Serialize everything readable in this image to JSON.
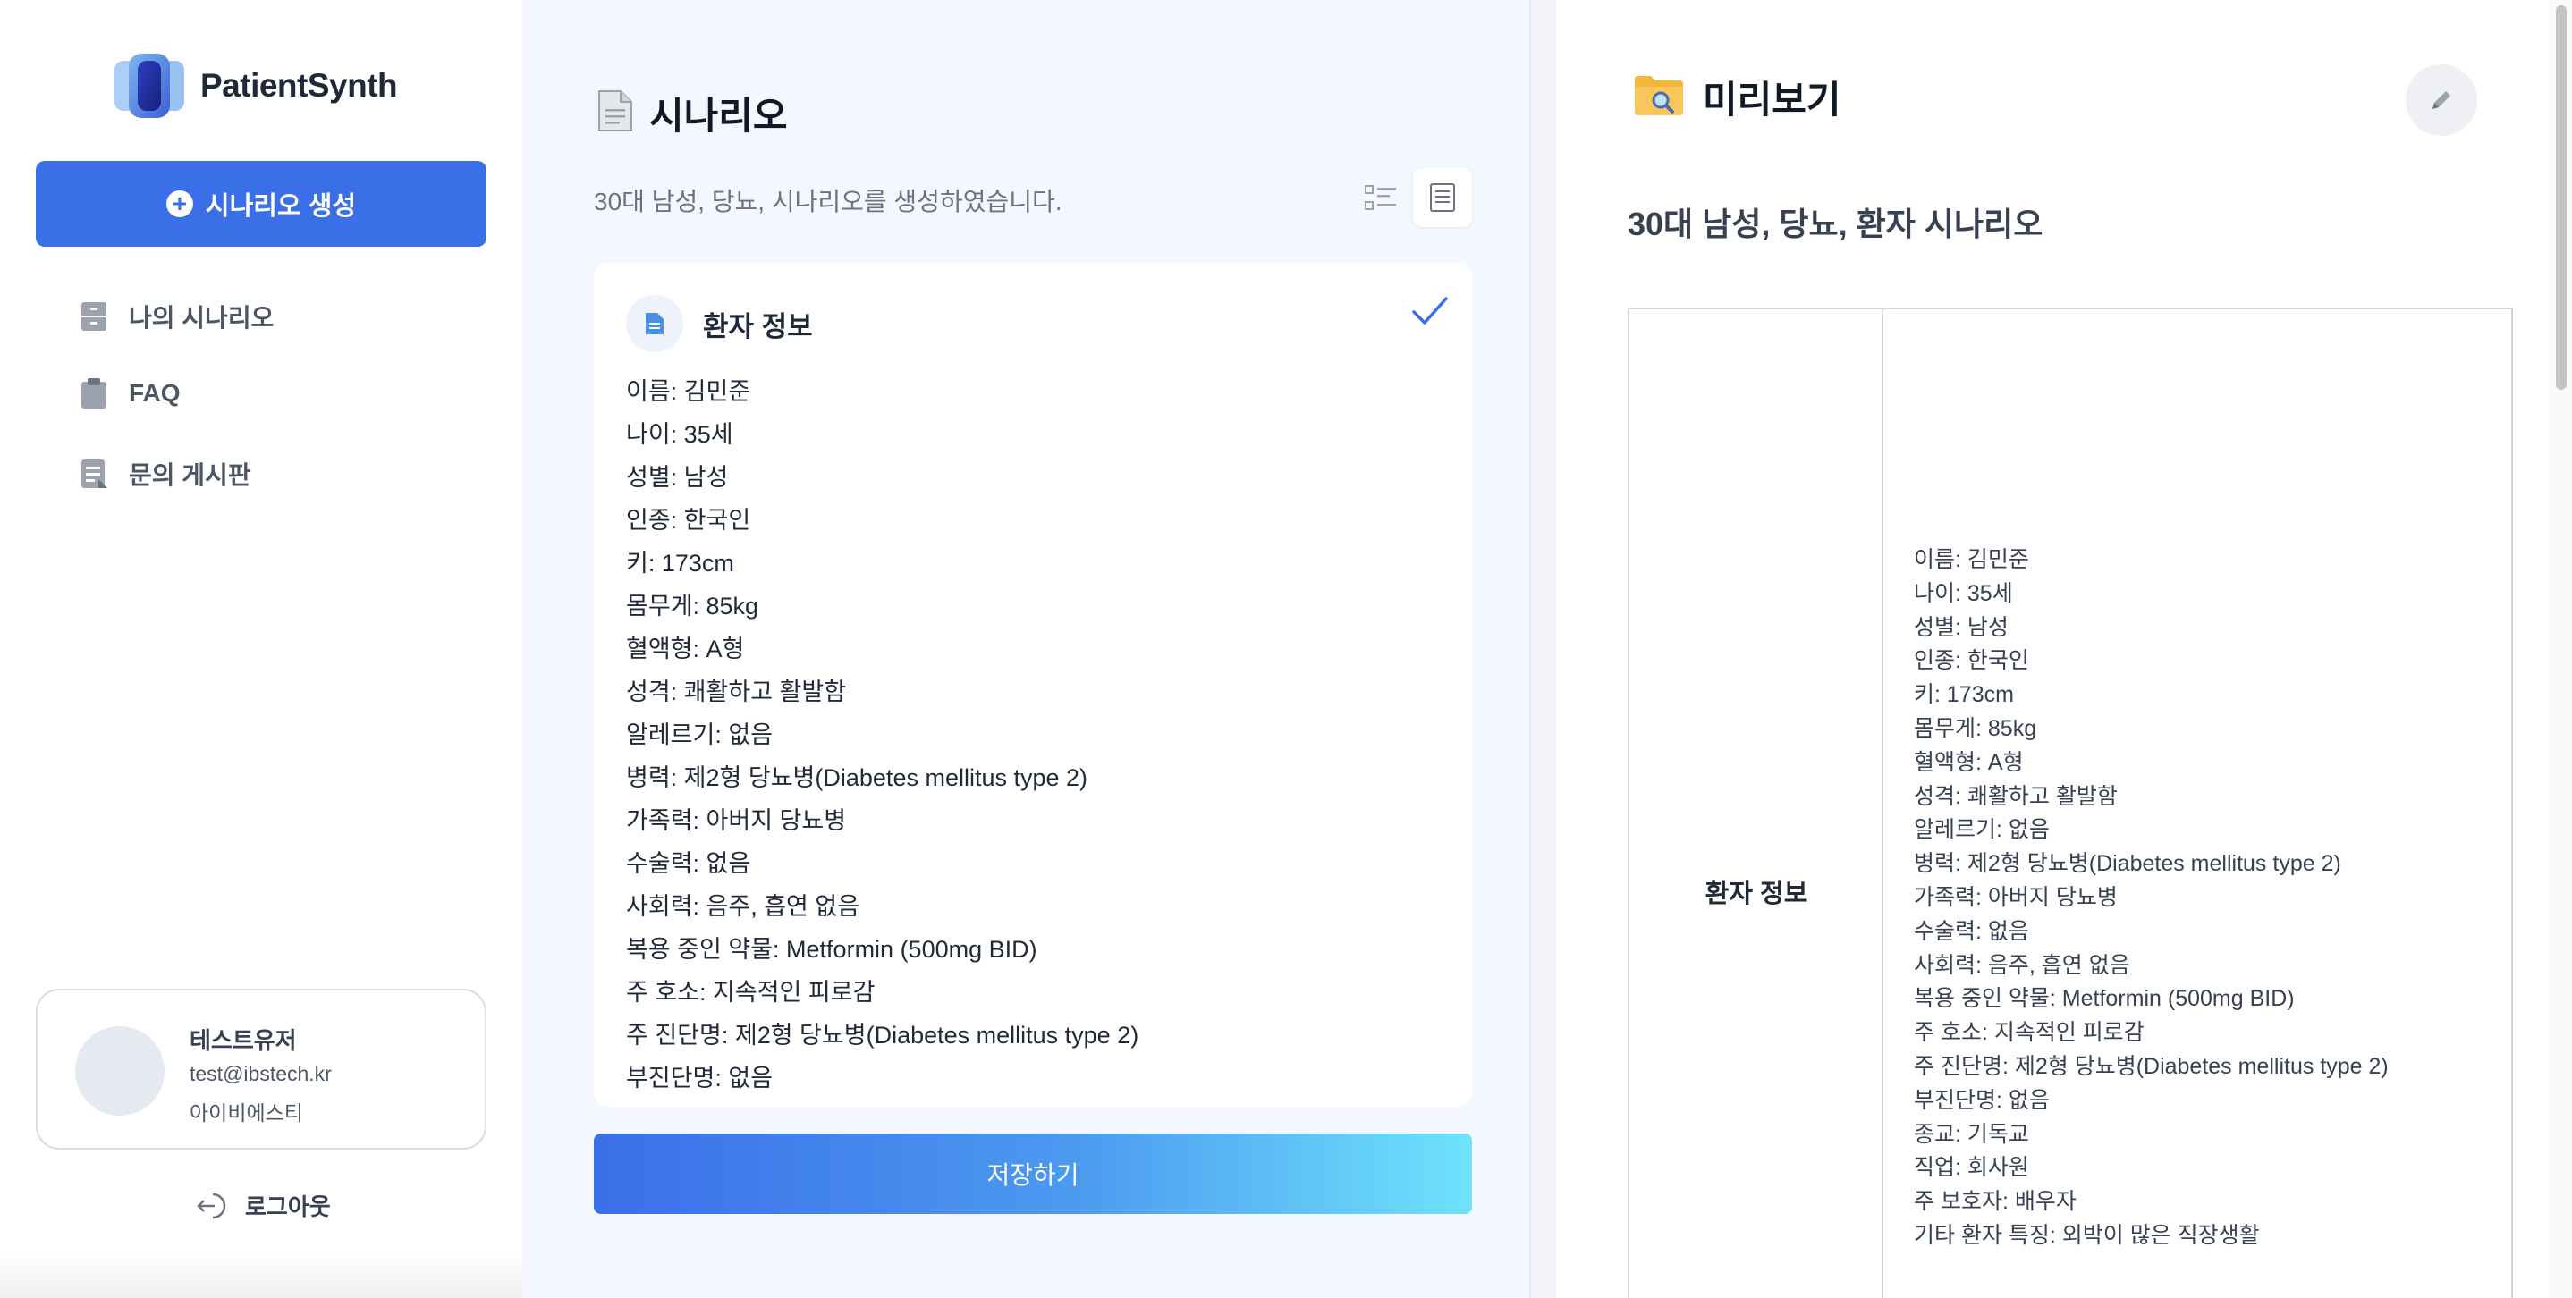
{
  "sidebar": {
    "brand": "PatientSynth",
    "create_button": "시나리오 생성",
    "items": [
      {
        "label": "나의 시나리오",
        "icon": "cabinet-icon"
      },
      {
        "label": "FAQ",
        "icon": "clipboard-icon"
      },
      {
        "label": "문의 게시판",
        "icon": "document-list-icon"
      }
    ],
    "profile": {
      "name": "테스트유저",
      "email": "test@ibstech.kr",
      "org": "아이비에스티"
    },
    "logout_label": "로그아웃"
  },
  "scenario": {
    "title": "시나리오",
    "subtitle": "30대 남성, 당뇨, 시나리오를 생성하였습니다.",
    "card_title": "환자 정보",
    "items": [
      "이름: 김민준",
      "나이: 35세",
      "성별: 남성",
      "인종: 한국인",
      "키: 173cm",
      "몸무게: 85kg",
      "혈액형: A형",
      "성격: 쾌활하고 활발함",
      "알레르기: 없음",
      "병력: 제2형 당뇨병(Diabetes mellitus type 2)",
      "가족력: 아버지 당뇨병",
      "수술력: 없음",
      "사회력: 음주, 흡연 없음",
      "복용 중인 약물: Metformin (500mg BID)",
      "주 호소: 지속적인 피로감",
      "주 진단명: 제2형 당뇨병(Diabetes mellitus type 2)",
      "부진단명: 없음"
    ],
    "save_button": "저장하기"
  },
  "preview": {
    "title": "미리보기",
    "doc_title": "30대 남성, 당뇨, 환자 시나리오",
    "section_label": "환자 정보",
    "items": [
      "이름: 김민준",
      "나이: 35세",
      "성별: 남성",
      "인종: 한국인",
      "키: 173cm",
      "몸무게: 85kg",
      "혈액형: A형",
      "성격: 쾌활하고 활발함",
      "알레르기: 없음",
      "병력: 제2형 당뇨병(Diabetes mellitus type 2)",
      "가족력: 아버지 당뇨병",
      "수술력: 없음",
      "사회력: 음주, 흡연 없음",
      "복용 중인 약물: Metformin (500mg BID)",
      "주 호소: 지속적인 피로감",
      "주 진단명: 제2형 당뇨병(Diabetes mellitus type 2)",
      "부진단명: 없음",
      "종교: 기독교",
      "직업: 회사원",
      "주 보호자: 배우자",
      "기타 환자 특징: 외박이 많은 직장생활"
    ]
  },
  "colors": {
    "primary": "#3b6fe8",
    "gradient_end": "#6ee3fb",
    "panel_bg": "#f4f7fd"
  }
}
